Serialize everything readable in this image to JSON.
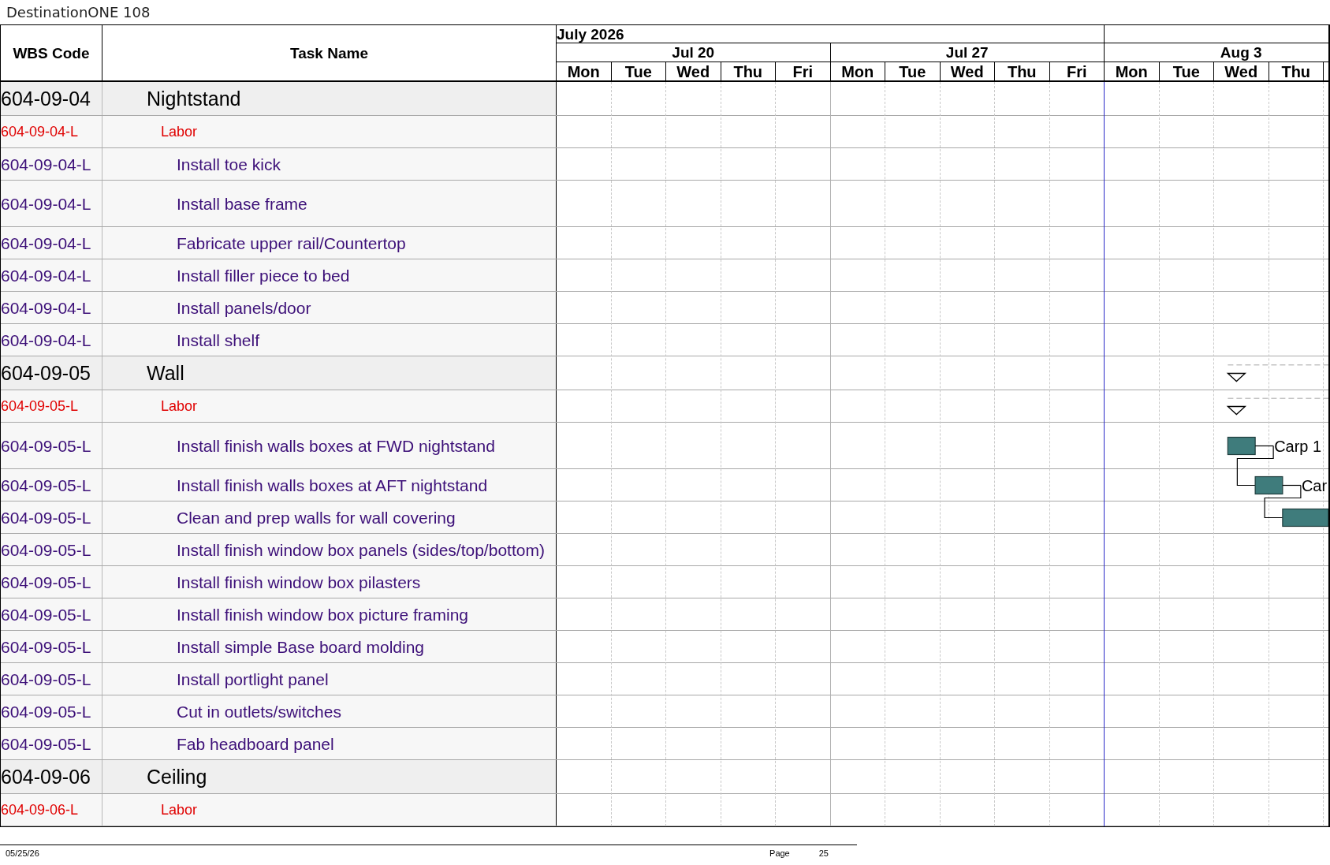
{
  "title": "DestinationONE 108",
  "table": {
    "columns": [
      "WBS Code",
      "Task Name"
    ],
    "timescale": {
      "months": [
        {
          "label": "July 2026",
          "weeks": [
            {
              "label": "Jul 20",
              "days": [
                "Mon",
                "Tue",
                "Wed",
                "Thu",
                "Fri"
              ]
            },
            {
              "label": "Jul 27",
              "days": [
                "Mon",
                "Tue",
                "Wed",
                "Thu",
                "Fri"
              ]
            }
          ]
        },
        {
          "weeks": [
            {
              "label": "Aug 3",
              "days": [
                "Mon",
                "Tue",
                "Wed",
                "Thu"
              ]
            }
          ]
        }
      ]
    },
    "rows": [
      {
        "kind": "group",
        "wbs": "604-09-04",
        "name": "Nightstand",
        "children": [
          {
            "kind": "labor",
            "wbs": "604-09-04-L",
            "name": "Labor",
            "children": [
              {
                "kind": "task",
                "wbs": "604-09-04-L",
                "name": "Install toe kick"
              },
              {
                "kind": "task",
                "wbs": "604-09-04-L",
                "name": "Install base frame"
              },
              {
                "kind": "task",
                "wbs": "604-09-04-L",
                "name": "Fabricate upper rail/Countertop"
              },
              {
                "kind": "task",
                "wbs": "604-09-04-L",
                "name": "Install filler piece to bed"
              },
              {
                "kind": "task",
                "wbs": "604-09-04-L",
                "name": "Install panels/door"
              },
              {
                "kind": "task",
                "wbs": "604-09-04-L",
                "name": "Install shelf"
              }
            ]
          }
        ]
      },
      {
        "kind": "group",
        "wbs": "604-09-05",
        "name": "Wall",
        "gantt": {
          "kind": "summary"
        },
        "children": [
          {
            "kind": "labor",
            "wbs": "604-09-05-L",
            "name": "Labor",
            "gantt": {
              "kind": "summary"
            },
            "children": [
              {
                "kind": "task",
                "wbs": "604-09-05-L",
                "name": "Install finish walls boxes at FWD nightstand",
                "gantt": {
                  "kind": "task",
                  "label": "Carp 1"
                }
              },
              {
                "kind": "task",
                "wbs": "604-09-05-L",
                "name": "Install finish walls boxes at AFT nightstand",
                "gantt": {
                  "kind": "task",
                  "label": "Car"
                }
              },
              {
                "kind": "task",
                "wbs": "604-09-05-L",
                "name": "Clean and prep walls for wall covering",
                "gantt": {
                  "kind": "task"
                }
              },
              {
                "kind": "task",
                "wbs": "604-09-05-L",
                "name": "Install finish window box panels (sides/top/bottom)"
              },
              {
                "kind": "task",
                "wbs": "604-09-05-L",
                "name": "Install finish window box pilasters"
              },
              {
                "kind": "task",
                "wbs": "604-09-05-L",
                "name": "Install finish window box picture framing"
              },
              {
                "kind": "task",
                "wbs": "604-09-05-L",
                "name": "Install simple Base board molding"
              },
              {
                "kind": "task",
                "wbs": "604-09-05-L",
                "name": "Install portlight panel"
              },
              {
                "kind": "task",
                "wbs": "604-09-05-L",
                "name": "Cut in outlets/switches"
              },
              {
                "kind": "task",
                "wbs": "604-09-05-L",
                "name": "Fab headboard panel"
              }
            ]
          }
        ]
      },
      {
        "kind": "group",
        "wbs": "604-09-06",
        "name": "Ceiling",
        "children": [
          {
            "kind": "labor",
            "wbs": "604-09-06-L",
            "name": "Labor"
          }
        ]
      }
    ]
  },
  "footer": {
    "date": "05/25/26",
    "page_label": "Page",
    "page_number": "25"
  }
}
